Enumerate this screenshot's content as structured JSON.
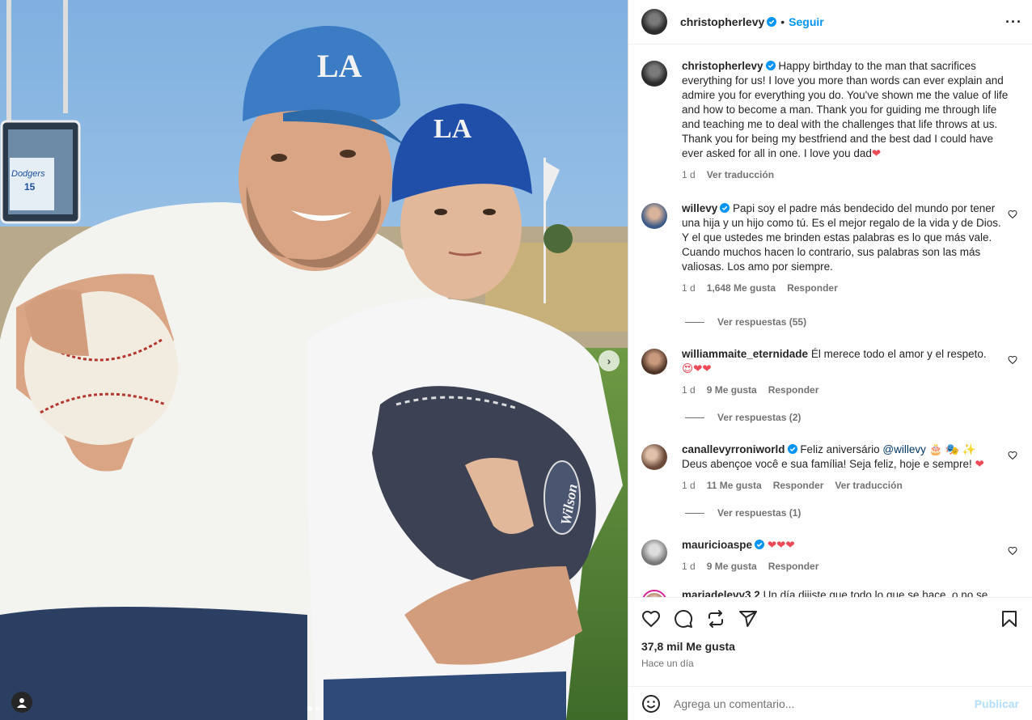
{
  "post": {
    "author": "christopherlevy",
    "separator": "•",
    "follow_label": "Seguir",
    "caption": "Happy birthday to the man that sacrifices everything for us! I love you more than words can ever explain and admire you for everything you do. You've shown me the value of life and how to become a man. Thank you for guiding me through life and teaching me to deal with the challenges that life throws at us. Thank you for being my bestfriend and the best dad I could have ever asked for all in one. I love you dad",
    "caption_emoji": "❤",
    "caption_time": "1 d",
    "caption_translate": "Ver traducción"
  },
  "comments": [
    {
      "user": "willevy",
      "verified": true,
      "text": "Papi soy el padre más bendecido del mundo por tener una hija y un hijo como tú. Es el mejor regalo de la vida y de Dios. Y el que ustedes me brinden estas palabras es lo que más vale. Cuando muchos hacen lo contrario, sus palabras son las más valiosas. Los amo por siempre.",
      "time": "1 d",
      "likes": "1,648 Me gusta",
      "reply": "Responder",
      "view_replies": "Ver respuestas (55)"
    },
    {
      "user": "williammaite_eternidade",
      "verified": false,
      "text": "Él merece todo el amor y el respeto.",
      "emojis": "😍❤❤",
      "time": "1 d",
      "likes": "9 Me gusta",
      "reply": "Responder",
      "view_replies": "Ver respuestas (2)"
    },
    {
      "user": "canallevyrroniworld",
      "verified": true,
      "text_before_mention": "Feliz aniversário",
      "mention": "@willevy",
      "text_after_mention": "🎂 🎭 ✨",
      "text_line2": "Deus abençoe você e sua família! Seja feliz, hoje e sempre!",
      "emoji_end": "❤",
      "time": "1 d",
      "likes": "11 Me gusta",
      "reply": "Responder",
      "translate": "Ver traducción",
      "view_replies": "Ver respuestas (1)"
    },
    {
      "user": "mauricioaspe",
      "verified": true,
      "emojis": "❤❤❤",
      "time": "1 d",
      "likes": "9 Me gusta",
      "reply": "Responder"
    },
    {
      "user": "mariadelevy3.2",
      "verified": false,
      "text": "Un día dijiste que todo lo que se hace, o no se"
    }
  ],
  "footer": {
    "likes": "37,8 mil Me gusta",
    "time": "Hace un día",
    "comment_placeholder": "Agrega un comentario...",
    "publish_label": "Publicar"
  },
  "photo": {
    "cap_logo": "LA",
    "glove_brand": "Wilson",
    "scoreboard_jersey": "Dodgers",
    "scoreboard_number": "15"
  },
  "icons": [
    "more-icon",
    "heart-icon",
    "comment-icon",
    "share-icon",
    "send-icon",
    "save-icon",
    "emoji-icon",
    "tag-user-icon",
    "next-arrow-icon",
    "verified-icon"
  ],
  "colors": {
    "accent": "#0095f6",
    "heart": "#ed4956",
    "text": "#262626",
    "muted": "#737373",
    "publish_disabled": "#b2dffc"
  }
}
